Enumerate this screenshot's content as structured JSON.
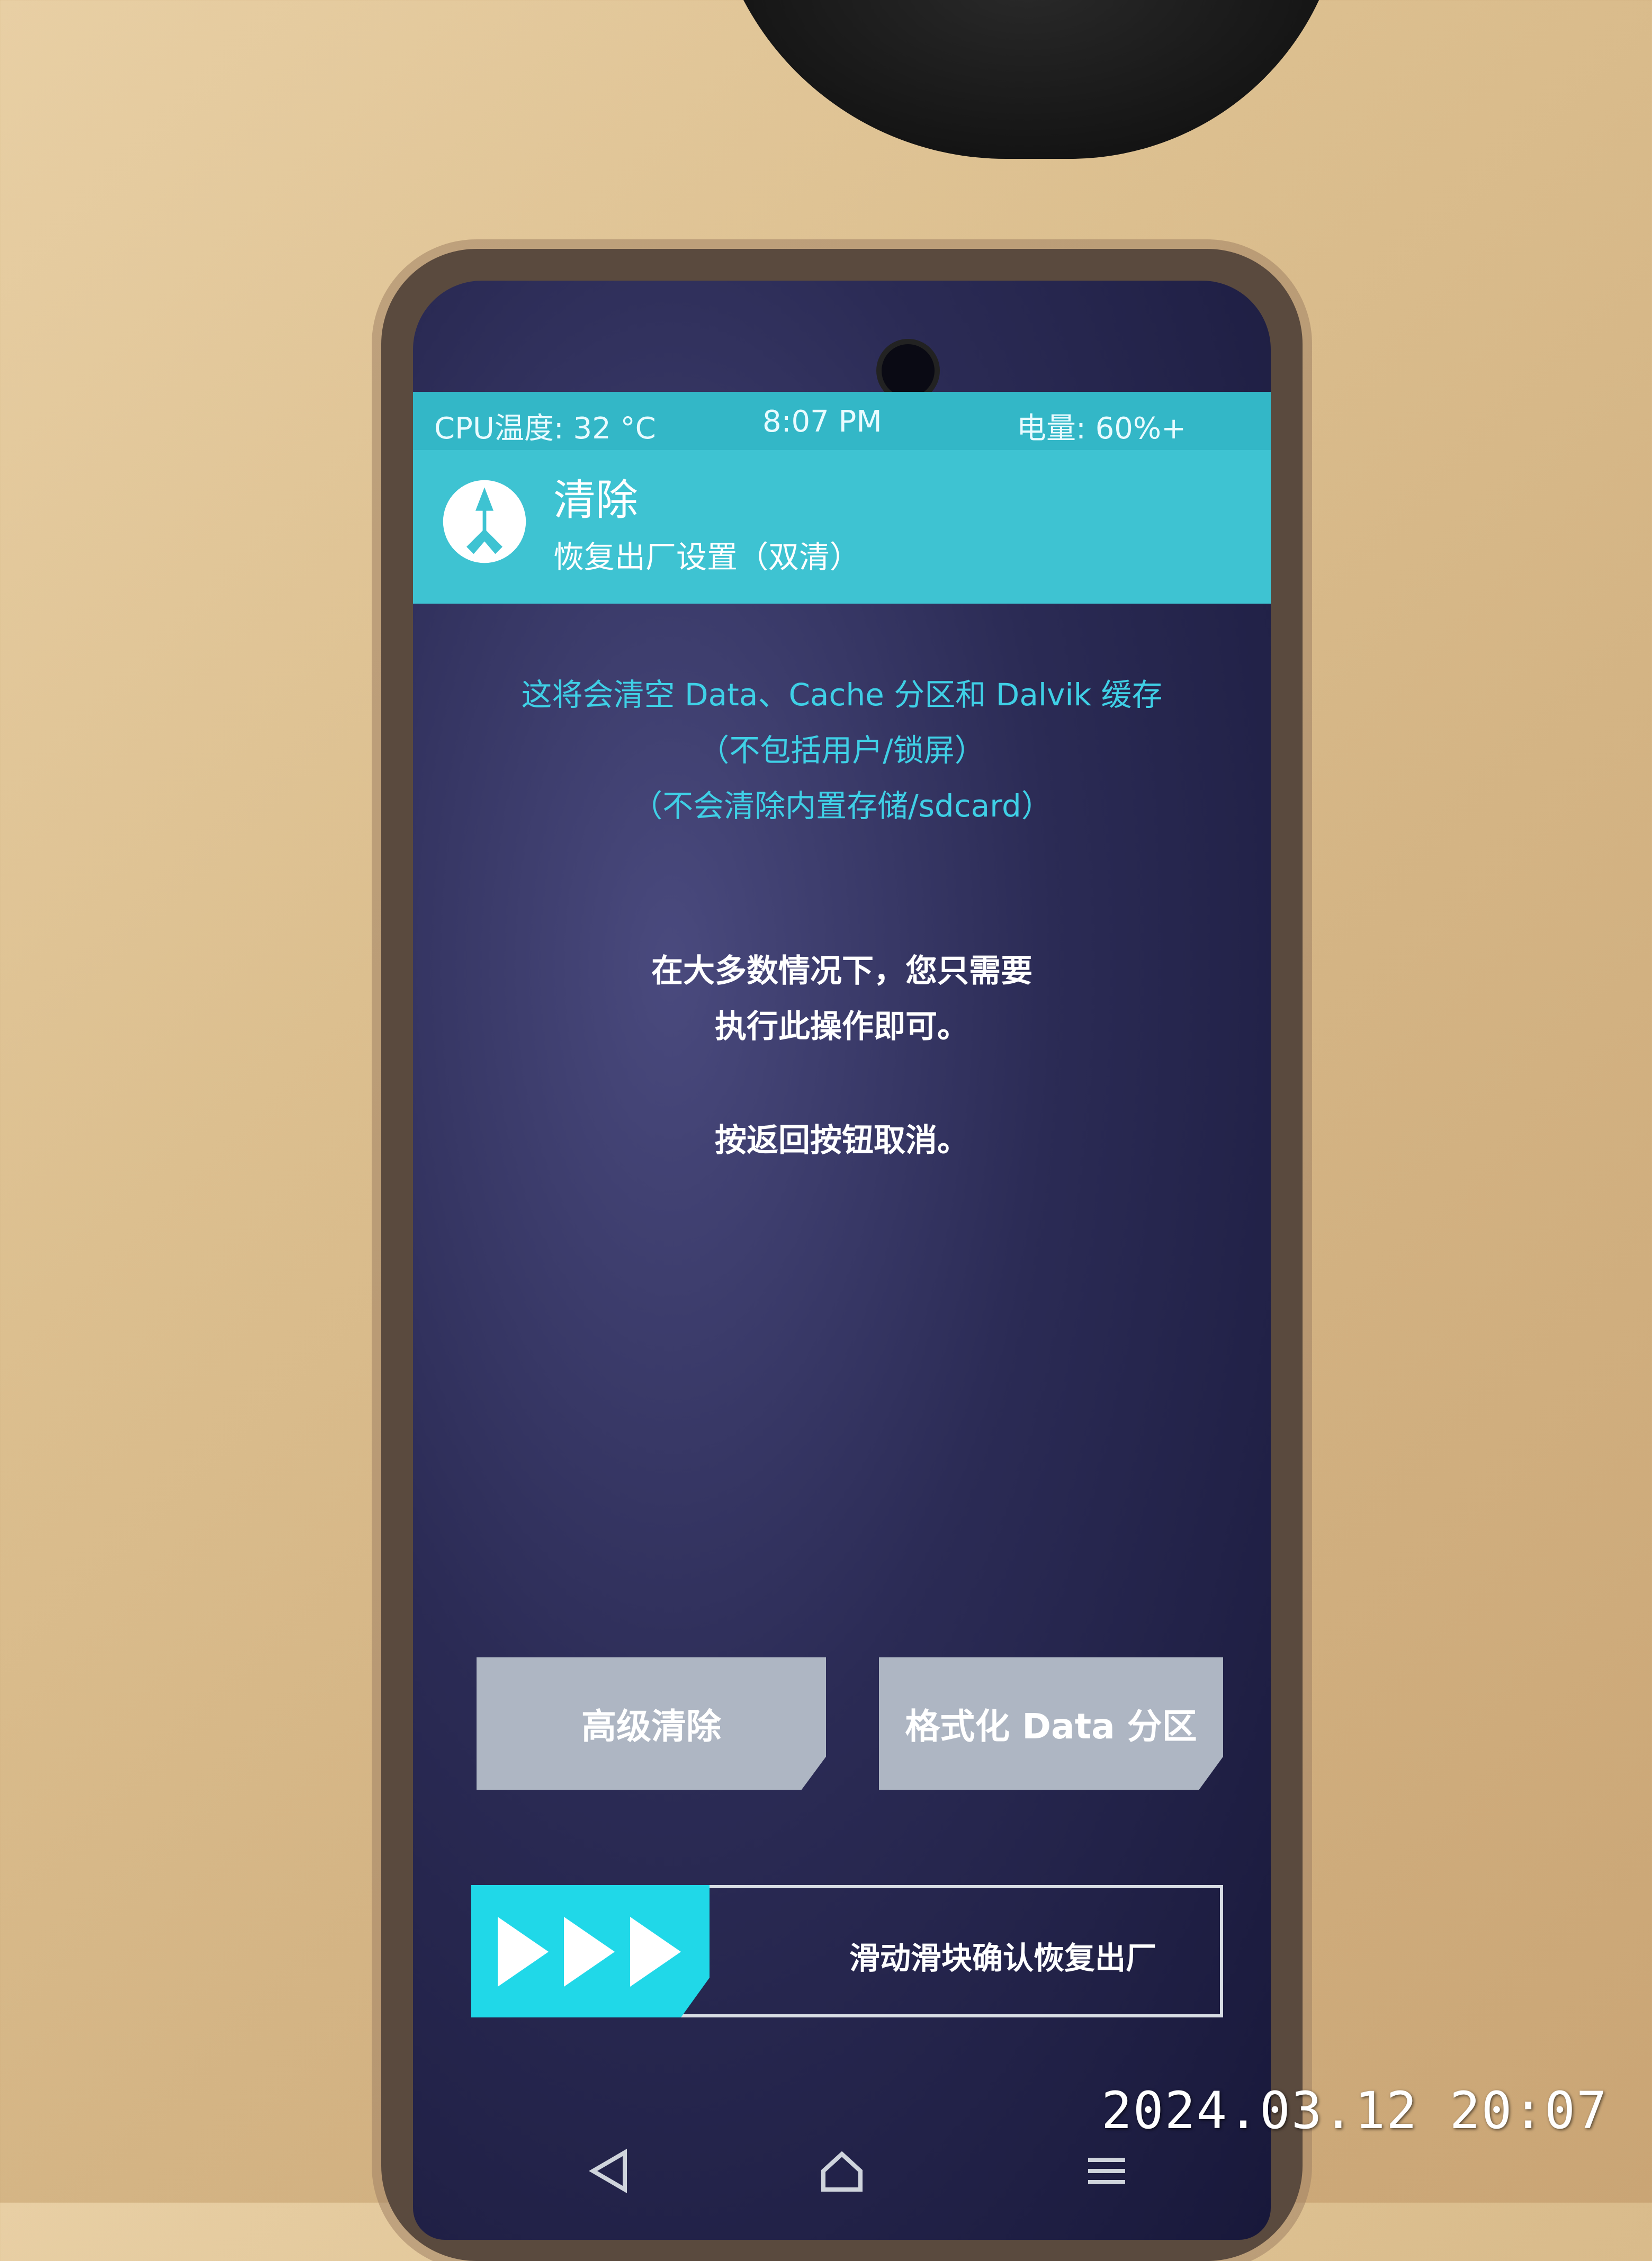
{
  "status": {
    "cpu_temp": "CPU温度: 32 °C",
    "time": "8:07 PM",
    "battery": "电量: 60%+"
  },
  "header": {
    "title": "清除",
    "subtitle": "恢复出厂设置（双清）"
  },
  "warning_lines": [
    "这将会清空 Data、Cache 分区和 Dalvik 缓存",
    "（不包括用户/锁屏）",
    "（不会清除内置存储/sdcard）"
  ],
  "info_lines": [
    "在大多数情况下，您只需要",
    "执行此操作即可。",
    "按返回按钮取消。"
  ],
  "buttons": {
    "advanced_wipe": "高级清除",
    "format_data": "格式化 Data 分区"
  },
  "slider": {
    "label": "滑动滑块确认恢复出厂"
  },
  "photo_timestamp": "2024.03.12  20:07",
  "colors": {
    "accent": "#3ec3d2",
    "warning_text": "#3fd0e6",
    "slider_knob": "#20d8e8",
    "button_bg": "#aeb6c3"
  }
}
